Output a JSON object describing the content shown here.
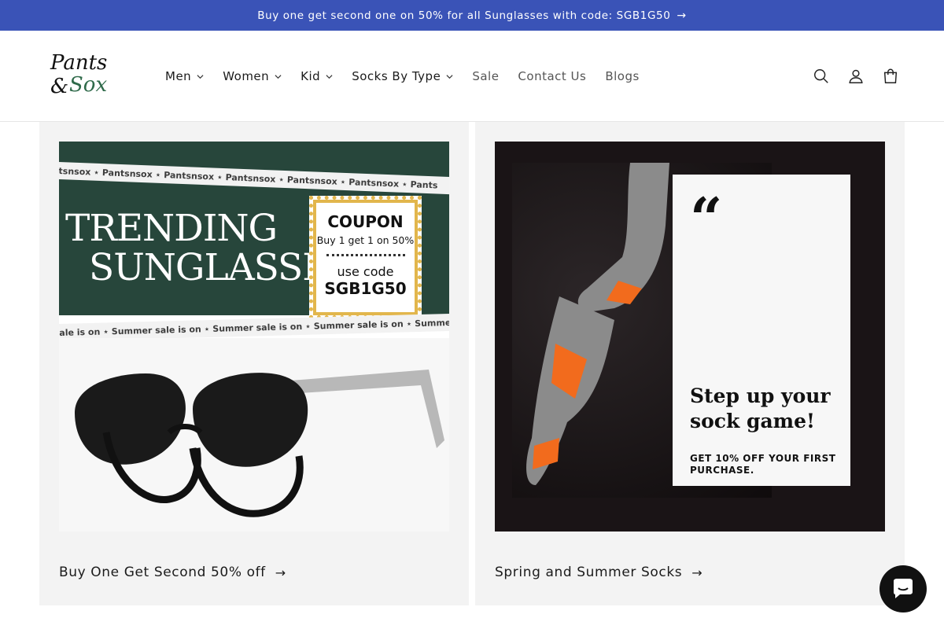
{
  "announcement": {
    "text": "Buy one get second one on 50% for all Sunglasses with code: SGB1G50",
    "arrow": "→"
  },
  "logo": {
    "line1": "Pants &",
    "line2": "Sox"
  },
  "nav": {
    "items": [
      {
        "label": "Men",
        "dropdown": true
      },
      {
        "label": "Women",
        "dropdown": true
      },
      {
        "label": "Kid",
        "dropdown": true
      },
      {
        "label": "Socks By Type",
        "dropdown": true
      },
      {
        "label": "Sale",
        "dropdown": false
      },
      {
        "label": "Contact Us",
        "dropdown": false
      },
      {
        "label": "Blogs",
        "dropdown": false
      }
    ]
  },
  "icons": {
    "search": "search-icon",
    "account": "account-icon",
    "cart": "cart-icon",
    "chat": "chat-icon"
  },
  "cards": [
    {
      "cta": "Buy One Get Second 50% off",
      "image": {
        "ticker_top": "tsnsox ⋆ Pantsnsox ⋆ Pantsnsox ⋆ Pantsnsox ⋆ Pantsnsox ⋆ Pantsnsox ⋆ Pants",
        "headline1": "TRENDING",
        "headline2": "SUNGLASSES",
        "coupon_title": "COUPON",
        "coupon_offer": "Buy 1 get 1 on 50%",
        "coupon_use": "use code",
        "coupon_code": "SGB1G50",
        "ticker_bottom": "ale is on ⋆ Summer sale is on ⋆ Summer sale is on ⋆ Summer sale is on ⋆ Summer sale is o"
      }
    },
    {
      "cta": "Spring and Summer Socks",
      "image": {
        "quote_mark": "“",
        "headline": "Step up your sock game!",
        "subline": "GET 10% OFF YOUR FIRST PURCHASE."
      }
    }
  ],
  "colors": {
    "announcement_bg": "#3a53b7",
    "card_bg": "#f3f3f3",
    "promo_green": "#27463b",
    "coupon_gold": "#e2b64c"
  }
}
